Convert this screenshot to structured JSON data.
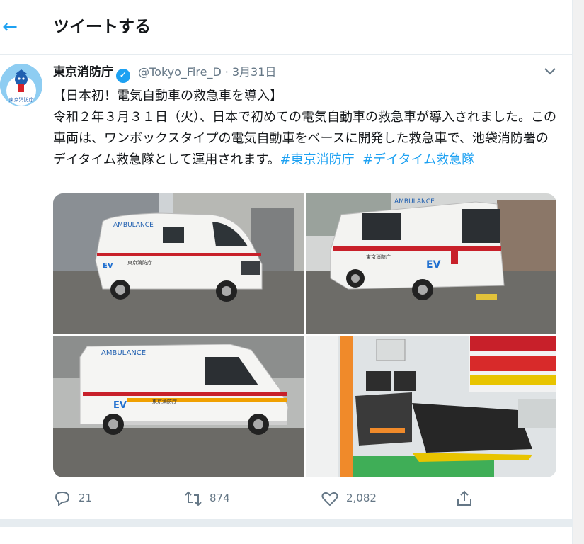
{
  "header": {
    "back_icon": "arrow-left-icon",
    "title": "ツイートする"
  },
  "tweet": {
    "author": {
      "display_name": "東京消防庁",
      "verified": true,
      "handle": "@Tokyo_Fire_D",
      "separator": "·",
      "date": "3月31日",
      "avatar_text": "東京消防庁"
    },
    "text": {
      "line1": "【日本初！電気自動車の救急車を導入】",
      "body": "令和２年３月３１日（火）、日本で初めての電気自動車の救急車が導入されました。この車両は、ワンボックスタイプの電気自動車をベースに開発した救急車で、池袋消防署のデイタイム救急隊として運用されます。",
      "hashtag1": "#東京消防庁",
      "hashtag2": "#デイタイム救急隊"
    },
    "media": {
      "photo1": {
        "label_ambulance": "AMBULANCE",
        "label_ev": "EV",
        "label_dept": "東京消防庁"
      },
      "photo2": {
        "label_ambulance": "AMBULANCE",
        "label_ev": "EV",
        "label_dept": "東京消防庁"
      },
      "photo3": {
        "label_ambulance": "AMBULANCE",
        "label_ev": "EV",
        "label_dept": "東京消防庁"
      }
    },
    "actions": {
      "reply_count": "21",
      "retweet_count": "874",
      "like_count": "2,082"
    }
  },
  "colors": {
    "accent": "#1da1f2",
    "secondary_text": "#657786",
    "divider": "#e6ecf0"
  }
}
